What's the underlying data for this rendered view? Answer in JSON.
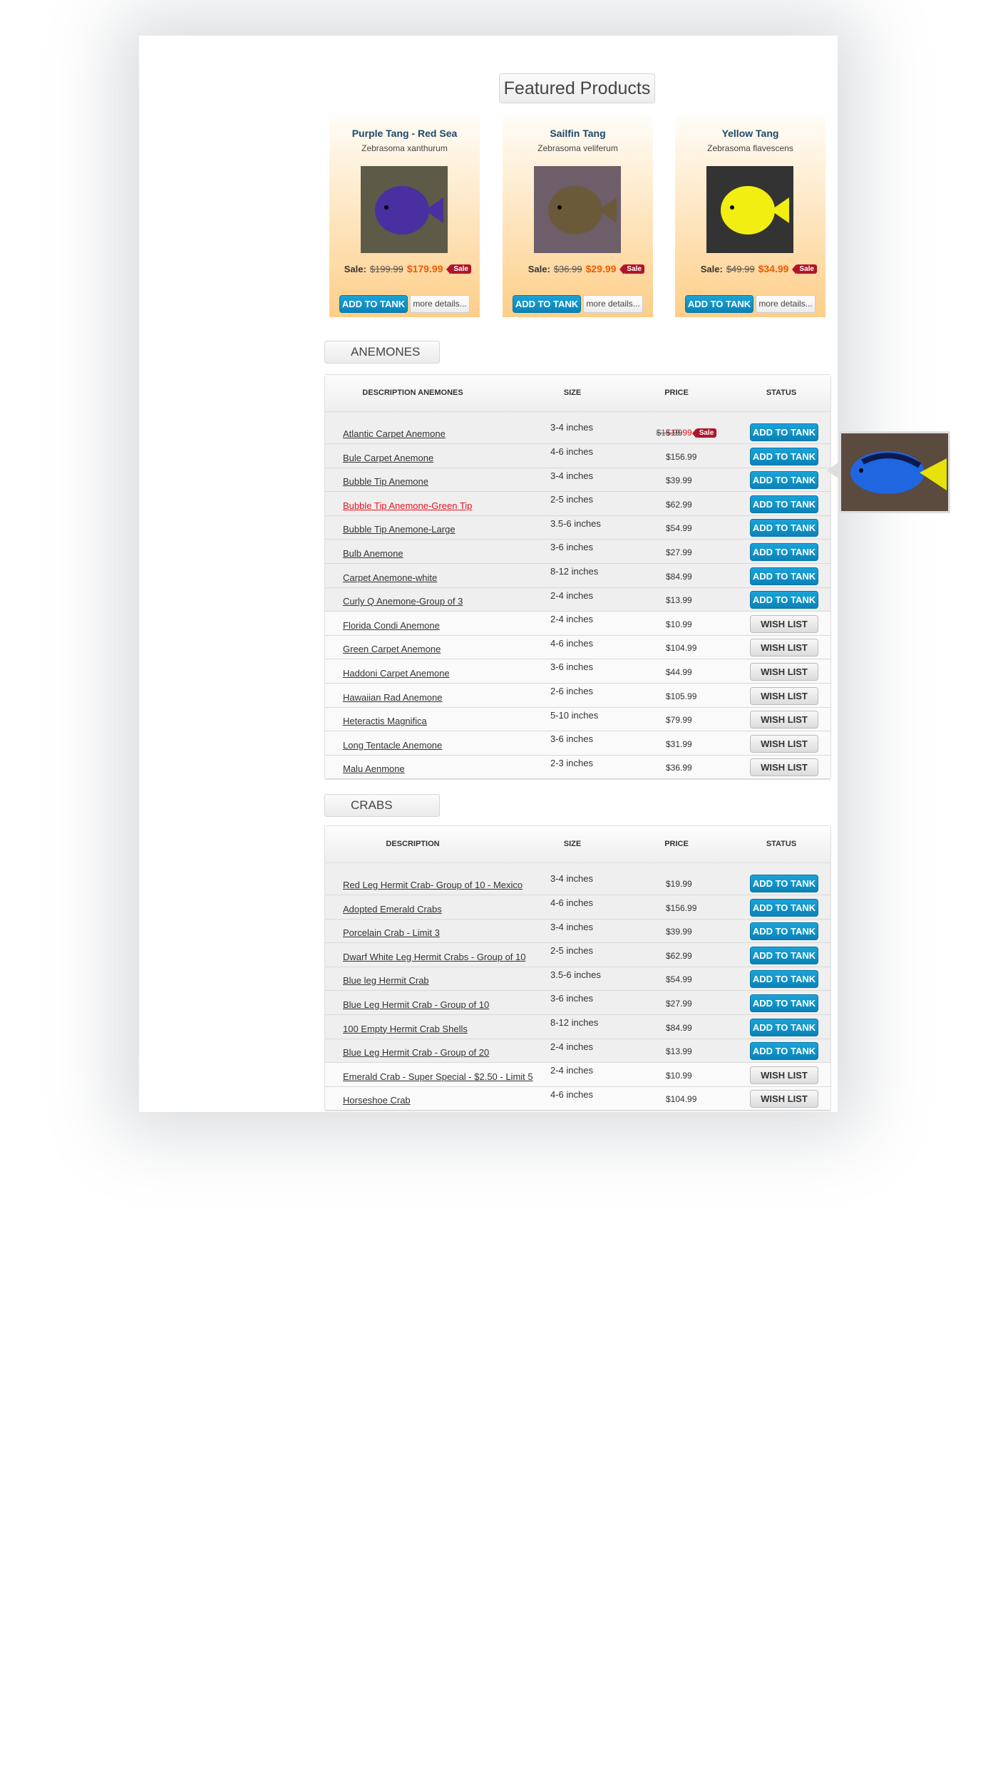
{
  "featured": {
    "title": "Featured Products",
    "sale_label": "Sale:",
    "sale_tag": "Sale",
    "add_label": "ADD TO TANK",
    "more_label": "more details...",
    "products": [
      {
        "name": "Purple Tang - Red Sea",
        "scientific": "Zebrasoma xanthurum",
        "old_price": "$199.99",
        "price": "$179.99",
        "fish_color": "#4a2fa0",
        "bg": "#5d5a48"
      },
      {
        "name": "Sailfin Tang",
        "scientific": "Zebrasoma veliferum",
        "old_price": "$36.99",
        "price": "$29.99",
        "fish_color": "#6b5a3a",
        "bg": "#6d5e6a"
      },
      {
        "name": "Yellow Tang",
        "scientific": "Zebrasoma flavescens",
        "old_price": "$49.99",
        "price": "$34.99",
        "fish_color": "#f2ee12",
        "bg": "#333"
      }
    ]
  },
  "sections": [
    {
      "tab": "ANEMONES",
      "headers": [
        "DESCRIPTION ANEMONES",
        "SIZE",
        "PRICE",
        "STATUS"
      ],
      "rows": [
        {
          "desc": "Atlantic Carpet Anemone",
          "size": "3-4 inches",
          "old_price": "$15.99",
          "price": "$19.99",
          "sale_tag": "Sale",
          "status": "ADD TO TANK"
        },
        {
          "desc": "Bule Carpet Anemone",
          "size": "4-6 inches",
          "price": "$156.99",
          "status": "ADD TO TANK"
        },
        {
          "desc": "Bubble Tip Anemone",
          "size": "3-4 inches",
          "price": "$39.99",
          "status": "ADD TO TANK"
        },
        {
          "desc": "Bubble Tip Anemone-Green Tip",
          "size": "2-5 inches",
          "price": "$62.99",
          "status": "ADD TO TANK",
          "highlight": true
        },
        {
          "desc": "Bubble Tip Anemone-Large",
          "size": "3.5-6 inches",
          "price": "$54.99",
          "status": "ADD TO TANK"
        },
        {
          "desc": "Bulb Anemone",
          "size": "3-6 inches",
          "price": "$27.99",
          "status": "ADD TO TANK"
        },
        {
          "desc": "Carpet Anemone-white",
          "size": "8-12 inches",
          "price": "$84.99",
          "status": "ADD TO TANK"
        },
        {
          "desc": "Curly Q Anemone-Group of 3",
          "size": "2-4 inches",
          "price": "$13.99",
          "status": "ADD TO TANK"
        },
        {
          "desc": "Florida Condi Anemone",
          "size": "2-4 inches",
          "price": "$10.99",
          "status": "WISH LIST"
        },
        {
          "desc": "Green Carpet Anemone",
          "size": "4-6 inches",
          "price": "$104.99",
          "status": "WISH LIST"
        },
        {
          "desc": "Haddoni Carpet Anemone",
          "size": "3-6 inches",
          "price": "$44.99",
          "status": "WISH LIST"
        },
        {
          "desc": "Hawaiian Rad Anemone",
          "size": "2-6 inches",
          "price": "$105.99",
          "status": "WISH LIST"
        },
        {
          "desc": "Heteractis Magnifica",
          "size": "5-10 inches",
          "price": "$79.99",
          "status": "WISH LIST"
        },
        {
          "desc": "Long Tentacle Anemone",
          "size": "3-6 inches",
          "price": "$31.99",
          "status": "WISH LIST"
        },
        {
          "desc": "Malu Aenmone",
          "size": "2-3 inches",
          "price": "$36.99",
          "status": "WISH LIST"
        }
      ]
    },
    {
      "tab": "CRABS",
      "headers": [
        "DESCRIPTION",
        "SIZE",
        "PRICE",
        "STATUS"
      ],
      "rows": [
        {
          "desc": "Red Leg Hermit Crab- Group of 10 - Mexico",
          "size": "3-4 inches",
          "price": "$19.99",
          "status": "ADD TO TANK"
        },
        {
          "desc": "Adopted Emerald Crabs",
          "size": "4-6 inches",
          "price": "$156.99",
          "status": "ADD TO TANK"
        },
        {
          "desc": "Porcelain Crab - Limit 3",
          "size": "3-4 inches",
          "price": "$39.99",
          "status": "ADD TO TANK"
        },
        {
          "desc": "Dwarf White Leg Hermit Crabs - Group of 10",
          "size": "2-5 inches",
          "price": "$62.99",
          "status": "ADD TO TANK"
        },
        {
          "desc": "Blue leg Hermit Crab",
          "size": "3.5-6 inches",
          "price": "$54.99",
          "status": "ADD TO TANK"
        },
        {
          "desc": "Blue Leg Hermit Crab - Group of 10",
          "size": "3-6 inches",
          "price": "$27.99",
          "status": "ADD TO TANK"
        },
        {
          "desc": "100 Empty Hermit Crab Shells",
          "size": "8-12 inches",
          "price": "$84.99",
          "status": "ADD TO TANK"
        },
        {
          "desc": "Blue Leg Hermit Crab - Group of 20",
          "size": "2-4 inches",
          "price": "$13.99",
          "status": "ADD TO TANK"
        },
        {
          "desc": "Emerald Crab - Super Special - $2.50 - Limit 5",
          "size": "2-4 inches",
          "price": "$10.99",
          "status": "WISH LIST"
        },
        {
          "desc": "Horseshoe Crab",
          "size": "4-6 inches",
          "price": "$104.99",
          "status": "WISH LIST"
        }
      ]
    }
  ],
  "colors": {
    "accent": "#0a8fc6",
    "sale": "#f05a00",
    "highlight": "#e8141e",
    "title": "#1d4868"
  }
}
